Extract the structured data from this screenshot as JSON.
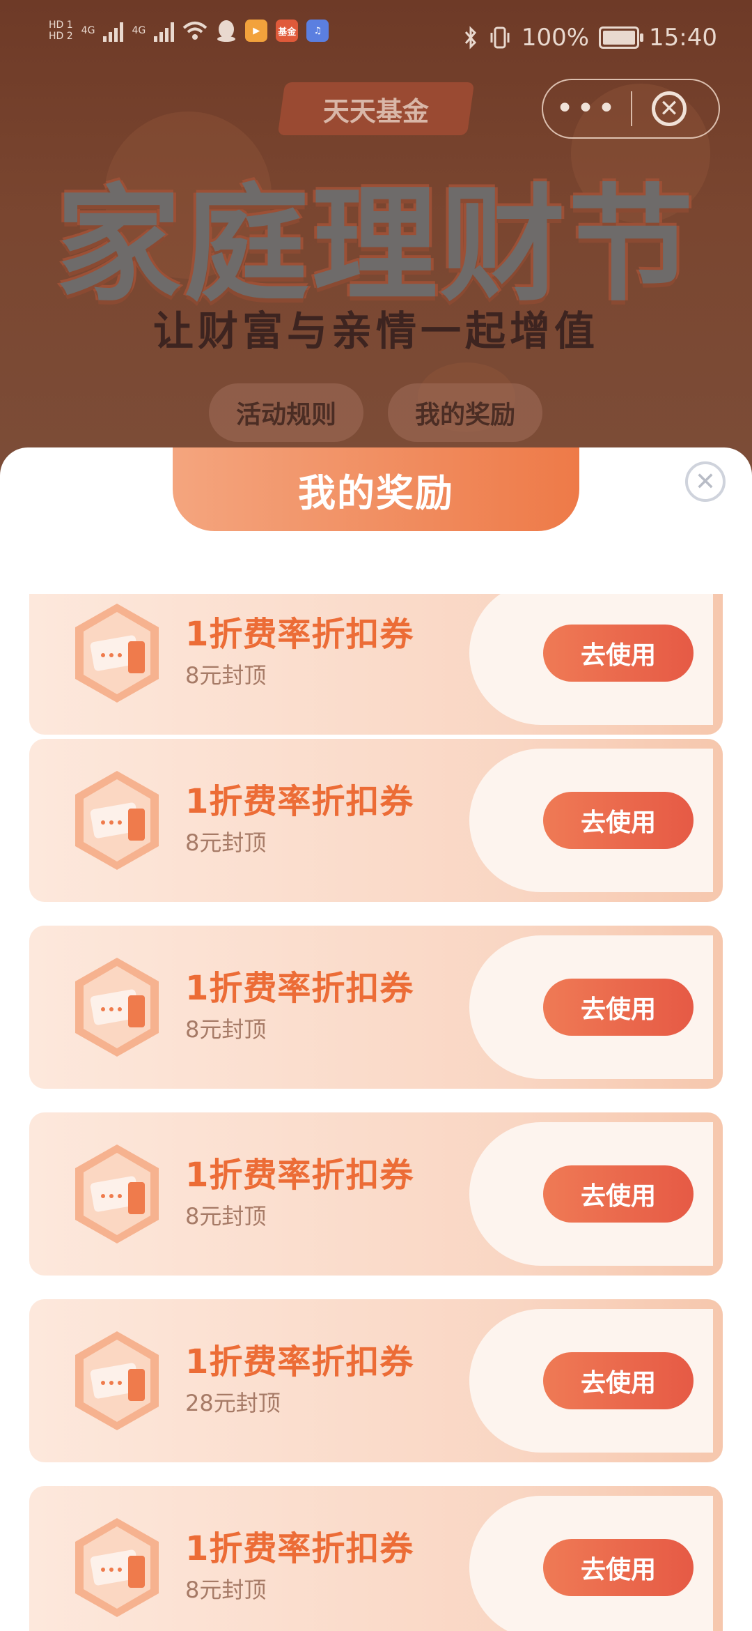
{
  "status_bar": {
    "sim1": "HD 1",
    "sim2": "HD 2",
    "net1": "4G",
    "net2": "4G",
    "battery_pct": "100%",
    "time": "15:40",
    "app_icons": [
      "qq-icon",
      "video-app-icon",
      "fund-app-icon",
      "music-app-icon"
    ],
    "fund_icon_text": "基金"
  },
  "mini_program": {
    "more_label": "•••",
    "close_label": "✕"
  },
  "hero": {
    "brand": "天天基金",
    "title": "家庭理财节",
    "subtitle": "让财富与亲情一起增值",
    "rules_button": "活动规则",
    "rewards_button": "我的奖励"
  },
  "sheet": {
    "title": "我的奖励",
    "close_label": "✕",
    "use_label": "去使用",
    "cards": [
      {
        "title": "1折费率折扣券",
        "cap": "8元封顶"
      },
      {
        "title": "1折费率折扣券",
        "cap": "8元封顶"
      },
      {
        "title": "1折费率折扣券",
        "cap": "8元封顶"
      },
      {
        "title": "1折费率折扣券",
        "cap": "8元封顶"
      },
      {
        "title": "1折费率折扣券",
        "cap": "28元封顶"
      },
      {
        "title": "1折费率折扣券",
        "cap": "8元封顶"
      }
    ]
  },
  "colors": {
    "accent": "#ec6c36",
    "button": "#e65a45",
    "card_bg": "#fde8dc"
  }
}
